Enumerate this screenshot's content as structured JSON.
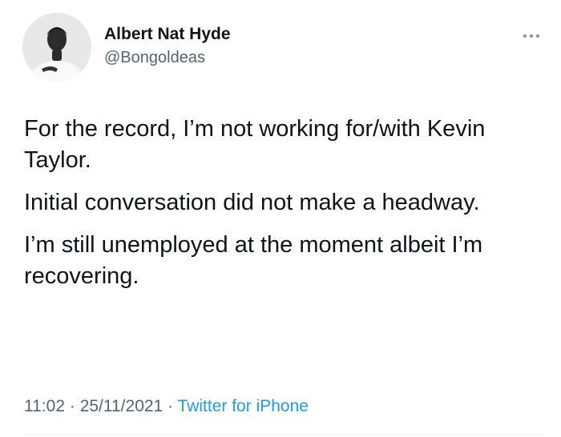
{
  "author": {
    "display_name": "Albert Nat Hyde",
    "handle": "@Bongoldeas",
    "avatar_icon": "profile-photo"
  },
  "menu": {
    "icon": "more-dots-icon"
  },
  "tweet": {
    "paragraphs": [
      "For the record, I’m not working for/with Kevin Taylor.",
      "Initial conversation did not make a headway.",
      "I’m still unemployed at the moment albeit I’m recovering."
    ]
  },
  "meta": {
    "time": "11:02",
    "separator": "·",
    "date": "25/11/2021",
    "source": "Twitter for iPhone"
  },
  "colors": {
    "text": "#0f1419",
    "secondary": "#536471",
    "link": "#1d9bf0"
  }
}
